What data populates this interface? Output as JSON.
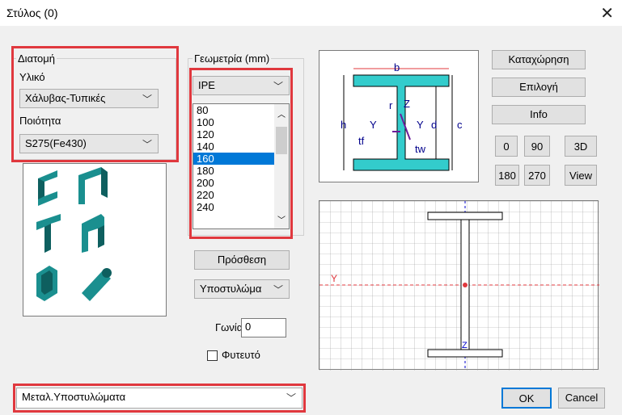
{
  "window": {
    "title": "Στύλος (0)",
    "close": "✕"
  },
  "section": {
    "group_title": "Διατομή",
    "material_label": "Υλικό",
    "material_value": "Χάλυβας-Τυπικές",
    "quality_label": "Ποιότητα",
    "quality_value": "S275(Fe430)"
  },
  "geometry": {
    "group_title": "Γεωμετρία (mm)",
    "profile_value": "IPE",
    "sizes": [
      "80",
      "100",
      "120",
      "140",
      "160",
      "180",
      "200",
      "220",
      "240"
    ],
    "selected_size": "160",
    "add_button": "Πρόσθεση",
    "type_value": "Υποστυλώμα",
    "angle_label": "Γωνία",
    "angle_value": "0",
    "planted_label": "Φυτευτό"
  },
  "right_buttons": {
    "register": "Καταχώρηση",
    "select": "Επιλογή",
    "info": "Info",
    "v0": "0",
    "v90": "90",
    "v3d": "3D",
    "v180": "180",
    "v270": "270",
    "view": "View"
  },
  "diagram": {
    "b": "b",
    "h": "h",
    "r": "r",
    "tf": "tf",
    "tw": "tw",
    "d": "d",
    "c": "c",
    "z": "Z",
    "y": "Y"
  },
  "preview": {
    "axis_y": "Y",
    "axis_z": "Z"
  },
  "bottom": {
    "category_value": "Μεταλ.Υποστυλώματα",
    "ok": "OK",
    "cancel": "Cancel"
  },
  "colors": {
    "red_highlight": "#e0383e",
    "section_fill": "#33cccc",
    "selection": "#0078d7"
  }
}
